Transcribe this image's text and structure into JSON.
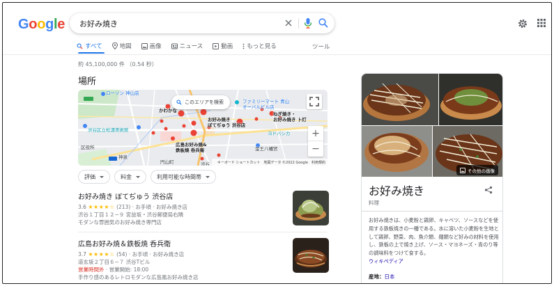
{
  "header": {
    "logo_letters": [
      {
        "char": "G",
        "color": "#4285f4"
      },
      {
        "char": "o",
        "color": "#ea4335"
      },
      {
        "char": "o",
        "color": "#fbbc05"
      },
      {
        "char": "g",
        "color": "#4285f4"
      },
      {
        "char": "l",
        "color": "#34a853"
      },
      {
        "char": "e",
        "color": "#ea4335"
      }
    ],
    "search_query": "お好み焼き",
    "icons": [
      "clear-icon",
      "mic-icon",
      "search-icon",
      "settings-icon",
      "apps-icon"
    ]
  },
  "tabs": [
    {
      "label": "すべて",
      "icon": "search-icon",
      "active": true
    },
    {
      "label": "地図",
      "icon": "map-pin-icon",
      "active": false
    },
    {
      "label": "画像",
      "icon": "image-icon",
      "active": false
    },
    {
      "label": "ニュース",
      "icon": "news-icon",
      "active": false
    },
    {
      "label": "動画",
      "icon": "video-icon",
      "active": false
    },
    {
      "label": "もっと見る",
      "icon": "more-vertical-icon",
      "active": false
    }
  ],
  "tools_label": "ツール",
  "result_stats": "約 45,100,000 件 （0.54 秒）",
  "places": {
    "title": "場所",
    "map": {
      "search_area_label": "このエリアを検索",
      "zoom_in": "+",
      "zoom_out": "−",
      "footer": [
        "キーボード ショートカット",
        "地図データ ©2022 Google",
        "利用規約"
      ],
      "labels": {
        "lawson": "ローソン 神山店",
        "familymart": "ファミリーマート 青山\nオーバルビル店",
        "kawakana": "かわかな",
        "botejyu": "お好み焼き\nぼてぢゅう 渋谷店",
        "negiyaki": "ねぎ焼き・\nお好み焼き 卜灯",
        "shoto": "渋谷区立松濤美術館",
        "hiroshima": "広島お好み焼&\n鉄板焼 呑兵衛",
        "yodobashi": "ヨドバシカ",
        "kinou": "金王八幡宮",
        "kamisen": "神泉",
        "shibuya": "渋谷",
        "kuyakusho": "区役所",
        "yamate": "円山町"
      }
    },
    "filters": [
      "評価",
      "料金",
      "利用可能な時間帯"
    ],
    "items": [
      {
        "name": "お好み焼き ぼてぢゅう 渋谷店",
        "rating": "3.6",
        "stars": "★★★★☆",
        "reviews": "(213)",
        "price_category": "· お手頃 · お好み焼き店",
        "address": "渋谷１丁目１２−９ 宮益坂・渋谷郵便局右隣",
        "description": "モダンな雰囲気のお好み焼き専門店"
      },
      {
        "name": "広島お好み焼＆鉄板焼 呑兵衛",
        "rating": "3.7",
        "stars": "★★★★☆",
        "reviews": "(54)",
        "price_category": "· お手頃 · お好み焼き店",
        "address": "道玄坂２丁目６−７ 渋谷Tビル",
        "hours_status": "営業時間外",
        "hours_open": " · 営業開始: 18:00",
        "description": "手作り感のあるレトロモダンな広島風お好み焼き店"
      }
    ]
  },
  "knowledge_panel": {
    "more_images_label": "その他の画像",
    "title": "お好み焼き",
    "subtitle": "料理",
    "description": "お好み焼きは、小麦粉と鶏卵、キャベツ、ソースなどを使用する鉄板焼きの一種である。水に溶いた小麦粉を生地として鶏卵、野菜、肉、魚介類、麺類など好みの材料を使用し、鉄板の上で焼き上げ、ソース・マヨネーズ・青のり等の調味料をつけて食する。",
    "wiki_link": "ウィキペディア",
    "fact_label": "産地：",
    "fact_value": "日本"
  }
}
